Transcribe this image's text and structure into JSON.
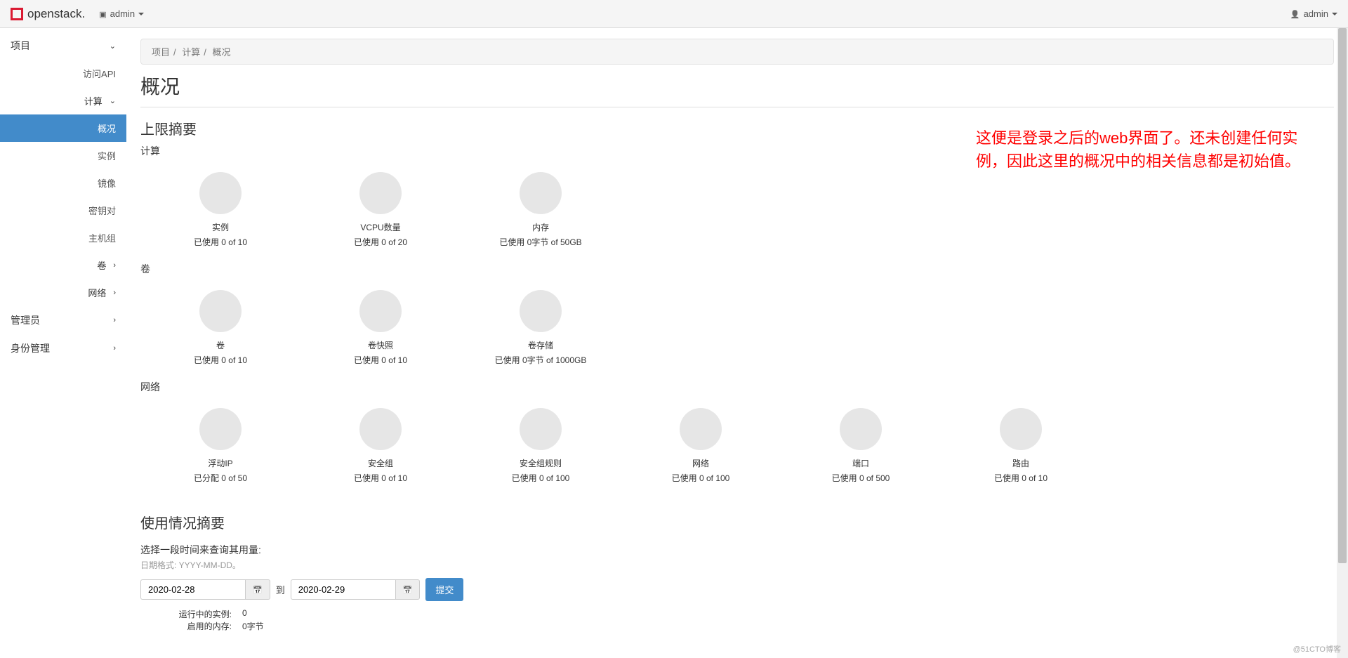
{
  "topbar": {
    "brand": "openstack.",
    "domain_label": "admin",
    "user_label": "admin"
  },
  "sidebar": {
    "project": "项目",
    "api": "访问API",
    "compute": "计算",
    "compute_items": {
      "overview": "概况",
      "instances": "实例",
      "images": "镜像",
      "keypairs": "密钥对",
      "hostgroups": "主机组"
    },
    "volumes": "卷",
    "network": "网络",
    "admin": "管理员",
    "identity": "身份管理"
  },
  "breadcrumb": {
    "a": "项目",
    "b": "计算",
    "c": "概况"
  },
  "page_title": "概况",
  "limit_summary": "上限摘要",
  "sections": {
    "compute": "计算",
    "volumes": "卷",
    "network": "网络"
  },
  "quotas": {
    "compute": [
      {
        "label": "实例",
        "usage": "已使用 0 of 10"
      },
      {
        "label": "VCPU数量",
        "usage": "已使用 0 of 20"
      },
      {
        "label": "内存",
        "usage": "已使用 0字节 of 50GB"
      }
    ],
    "volumes": [
      {
        "label": "卷",
        "usage": "已使用 0 of 10"
      },
      {
        "label": "卷快照",
        "usage": "已使用 0 of 10"
      },
      {
        "label": "卷存储",
        "usage": "已使用 0字节 of 1000GB"
      }
    ],
    "network": [
      {
        "label": "浮动IP",
        "usage": "已分配 0 of 50"
      },
      {
        "label": "安全组",
        "usage": "已使用 0 of 10"
      },
      {
        "label": "安全组规则",
        "usage": "已使用 0 of 100"
      },
      {
        "label": "网络",
        "usage": "已使用 0 of 100"
      },
      {
        "label": "端口",
        "usage": "已使用 0 of 500"
      },
      {
        "label": "路由",
        "usage": "已使用 0 of 10"
      }
    ]
  },
  "annotation": "这便是登录之后的web界面了。还未创建任何实例，因此这里的概况中的相关信息都是初始值。",
  "usage": {
    "title": "使用情况摘要",
    "query_label": "选择一段时间来查询其用量:",
    "hint": "日期格式: YYYY-MM-DD。",
    "from": "2020-02-28",
    "to_label": "到",
    "to": "2020-02-29",
    "submit": "提交",
    "running_instances_k": "运行中的实例:",
    "running_instances_v": "0",
    "used_ram_k": "启用的内存:",
    "used_ram_v": "0字节"
  },
  "watermark": "@51CTO博客"
}
